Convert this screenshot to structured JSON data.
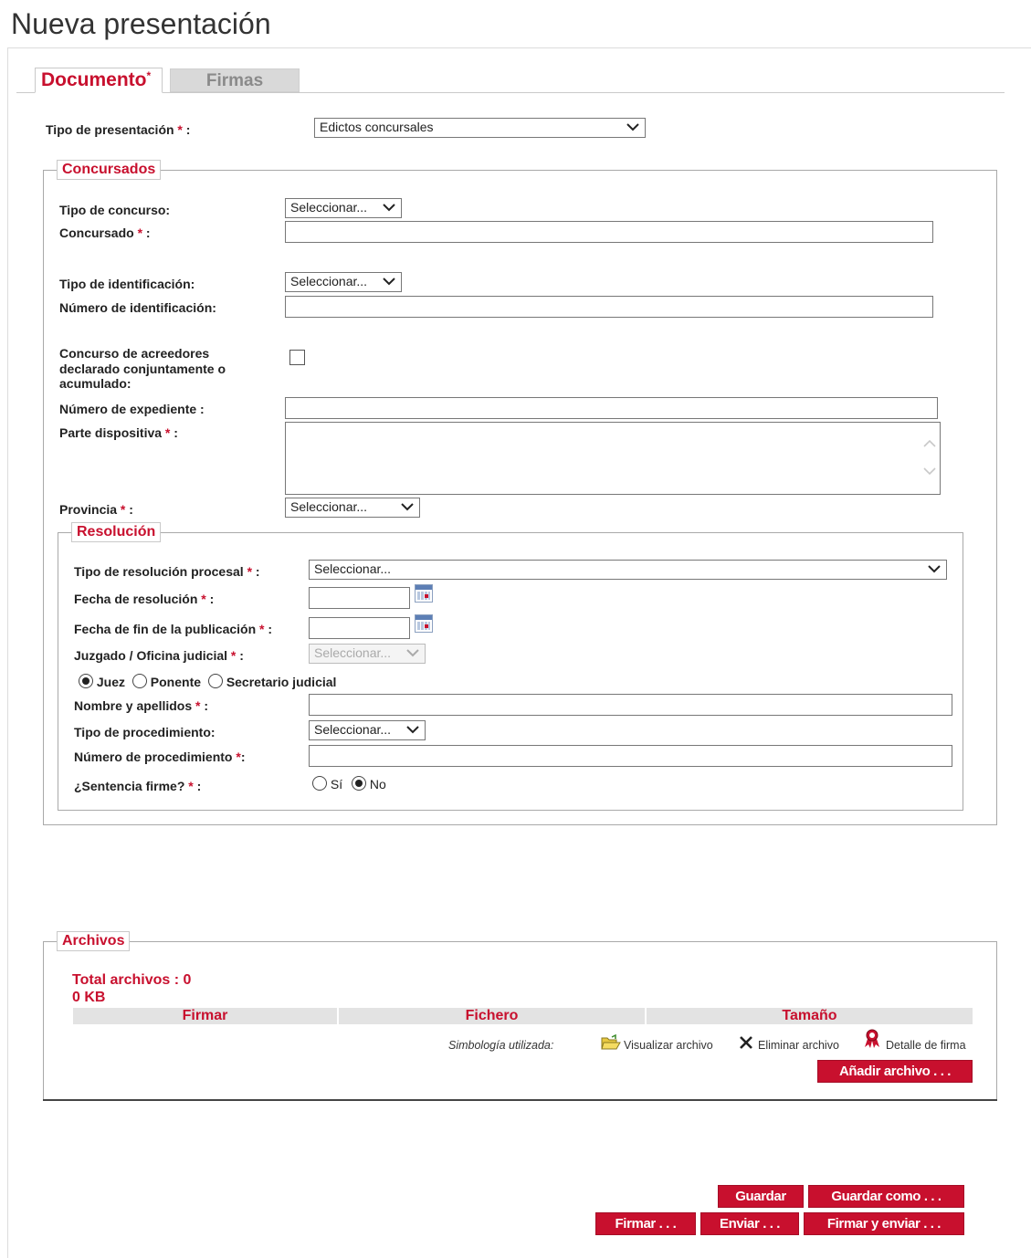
{
  "page_title": "Nueva presentación",
  "tabs": [
    {
      "label": "Documento",
      "required_mark": "*"
    },
    {
      "label": "Firmas"
    }
  ],
  "tipo_presentacion": {
    "label": "Tipo de presentación",
    "req": " * ",
    "colon": ":",
    "value": "Edictos concursales"
  },
  "concursados": {
    "legend": "Concursados",
    "tipo_concurso": {
      "label": "Tipo de concurso:",
      "value": "Seleccionar..."
    },
    "concursado": {
      "label": "Concursado",
      "req": " * ",
      "colon": ":",
      "value": ""
    },
    "tipo_identificacion": {
      "label": "Tipo de identificación:",
      "value": "Seleccionar..."
    },
    "numero_identificacion": {
      "label": "Número de identificación:",
      "value": ""
    },
    "concurso_acreedores": {
      "line1": "Concurso de acreedores",
      "line2": "declarado conjuntamente o",
      "line3": "acumulado:",
      "checked": false
    },
    "numero_expediente": {
      "label": "Número de expediente :",
      "value": ""
    },
    "parte_dispositiva": {
      "label": "Parte dispositiva",
      "req": " * ",
      "colon": ":",
      "value": ""
    },
    "provincia": {
      "label": "Provincia",
      "req": " * ",
      "colon": ":",
      "value": "Seleccionar..."
    }
  },
  "resolucion": {
    "legend": "Resolución",
    "tipo_resolucion": {
      "label": "Tipo de resolución procesal",
      "req": " * ",
      "colon": ":",
      "value": "Seleccionar..."
    },
    "fecha_resolucion": {
      "label": "Fecha de resolución",
      "req": " * ",
      "colon": ":",
      "value": ""
    },
    "fecha_fin": {
      "label": "Fecha de fin de la publicación",
      "req": " * ",
      "colon": ":",
      "value": ""
    },
    "juzgado": {
      "label": "Juzgado / Oficina judicial",
      "req": " * ",
      "colon": ":",
      "value": "Seleccionar..."
    },
    "rol": {
      "options": [
        "Juez",
        "Ponente",
        "Secretario judicial"
      ],
      "selected": "Juez"
    },
    "nombre": {
      "label": "Nombre y apellidos",
      "req": " * ",
      "colon": ":",
      "value": ""
    },
    "tipo_procedimiento": {
      "label": "Tipo de procedimiento:",
      "value": "Seleccionar..."
    },
    "numero_procedimiento": {
      "label": "Número de procedimiento",
      "req": " *",
      "colon": ":",
      "value": ""
    },
    "sentencia_firme": {
      "label": "¿Sentencia firme?",
      "req": " * ",
      "colon": ":",
      "options": [
        "Sí",
        "No"
      ],
      "selected": "No"
    }
  },
  "archivos": {
    "legend": "Archivos",
    "total": "Total archivos : 0",
    "size": "0 KB",
    "columns": [
      "Firmar",
      "Fichero",
      "Tamaño"
    ],
    "simbologia": "Simbología utilizada:",
    "legend_items": [
      "Visualizar archivo",
      "Eliminar archivo",
      "Detalle de firma"
    ],
    "add_button": "Añadir archivo . . ."
  },
  "actions": {
    "guardar": "Guardar",
    "guardar_como": "Guardar como . . .",
    "firmar": "Firmar . . .",
    "enviar": "Enviar . . .",
    "firmar_enviar": "Firmar y enviar . . ."
  },
  "colors": {
    "accent": "#c8102e",
    "tab_inactive": "#d9d9d9",
    "table_header": "#e3e3e3"
  }
}
